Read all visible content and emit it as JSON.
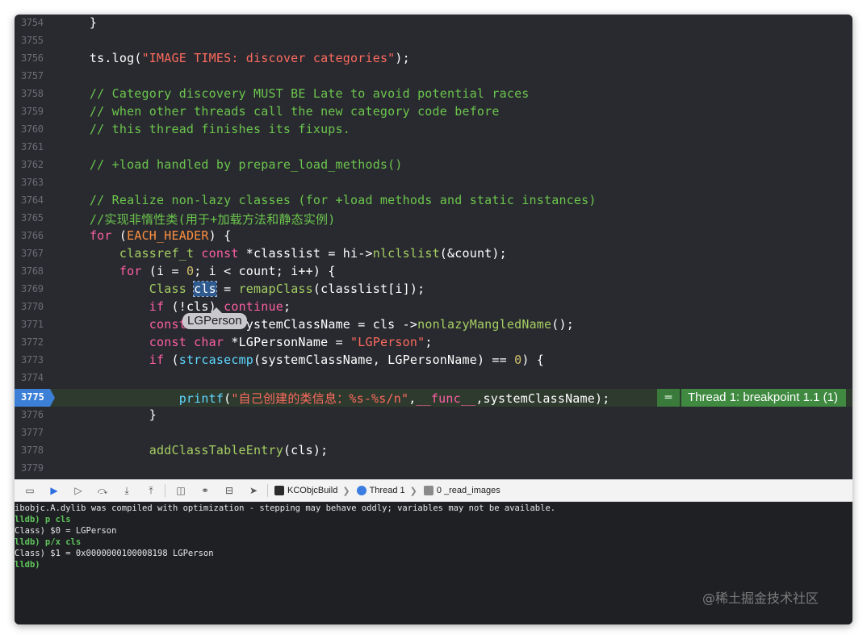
{
  "editor": {
    "lines": [
      {
        "n": "3754",
        "segs": [
          {
            "t": "    }",
            "c": ""
          }
        ]
      },
      {
        "n": "3755",
        "segs": []
      },
      {
        "n": "3756",
        "segs": [
          {
            "t": "    ts.",
            "c": ""
          },
          {
            "t": "log",
            "c": ""
          },
          {
            "t": "(",
            "c": ""
          },
          {
            "t": "\"IMAGE TIMES: discover categories\"",
            "c": "st"
          },
          {
            "t": ");",
            "c": ""
          }
        ]
      },
      {
        "n": "3757",
        "segs": []
      },
      {
        "n": "3758",
        "segs": [
          {
            "t": "    // Category discovery MUST BE Late to avoid potential races",
            "c": "cm"
          }
        ]
      },
      {
        "n": "3759",
        "segs": [
          {
            "t": "    // when other threads call the new category code before",
            "c": "cm"
          }
        ]
      },
      {
        "n": "3760",
        "segs": [
          {
            "t": "    // this thread finishes its fixups.",
            "c": "cm"
          }
        ]
      },
      {
        "n": "3761",
        "segs": []
      },
      {
        "n": "3762",
        "segs": [
          {
            "t": "    // +load handled by prepare_load_methods()",
            "c": "cm"
          }
        ]
      },
      {
        "n": "3763",
        "segs": []
      },
      {
        "n": "3764",
        "segs": [
          {
            "t": "    // Realize non-lazy classes (for +load methods and static instances)",
            "c": "cm"
          }
        ]
      },
      {
        "n": "3765",
        "segs": [
          {
            "t": "    //实现非惰性类(用于+加载方法和静态实例)",
            "c": "cm"
          }
        ]
      },
      {
        "n": "3766",
        "segs": [
          {
            "t": "    ",
            "c": ""
          },
          {
            "t": "for",
            "c": "kw"
          },
          {
            "t": " (",
            "c": ""
          },
          {
            "t": "EACH_HEADER",
            "c": "mac"
          },
          {
            "t": ") {",
            "c": ""
          }
        ]
      },
      {
        "n": "3767",
        "segs": [
          {
            "t": "        ",
            "c": ""
          },
          {
            "t": "classref_t",
            "c": "fn"
          },
          {
            "t": " ",
            "c": ""
          },
          {
            "t": "const",
            "c": "kw"
          },
          {
            "t": " *classlist = hi->",
            "c": ""
          },
          {
            "t": "nlclslist",
            "c": "fn"
          },
          {
            "t": "(&count);",
            "c": ""
          }
        ]
      },
      {
        "n": "3768",
        "segs": [
          {
            "t": "        ",
            "c": ""
          },
          {
            "t": "for",
            "c": "kw"
          },
          {
            "t": " (i = ",
            "c": ""
          },
          {
            "t": "0",
            "c": "num"
          },
          {
            "t": "; i < count; i++) {",
            "c": ""
          }
        ]
      },
      {
        "n": "3769",
        "segs": [
          {
            "t": "            ",
            "c": ""
          },
          {
            "t": "Class",
            "c": "fn"
          },
          {
            "t": " ",
            "c": ""
          },
          {
            "t": "cls",
            "c": "cur"
          },
          {
            "t": " = ",
            "c": ""
          },
          {
            "t": "remapClass",
            "c": "fn"
          },
          {
            "t": "(classlist[i]);",
            "c": ""
          }
        ]
      },
      {
        "n": "3770",
        "segs": [
          {
            "t": "            ",
            "c": ""
          },
          {
            "t": "if",
            "c": "kw"
          },
          {
            "t": " (!cls) ",
            "c": ""
          },
          {
            "t": "continue",
            "c": "kw"
          },
          {
            "t": ";",
            "c": ""
          }
        ]
      },
      {
        "n": "3771",
        "segs": [
          {
            "t": "            ",
            "c": ""
          },
          {
            "t": "const",
            "c": "kw"
          },
          {
            "t": " ",
            "c": ""
          },
          {
            "t": "char",
            "c": "kw"
          },
          {
            "t": " *systemClassName = cls ->",
            "c": ""
          },
          {
            "t": "nonlazyMangledName",
            "c": "fn"
          },
          {
            "t": "();",
            "c": ""
          }
        ]
      },
      {
        "n": "3772",
        "segs": [
          {
            "t": "            ",
            "c": ""
          },
          {
            "t": "const",
            "c": "kw"
          },
          {
            "t": " ",
            "c": ""
          },
          {
            "t": "char",
            "c": "kw"
          },
          {
            "t": " *LGPersonName = ",
            "c": ""
          },
          {
            "t": "\"LGPerson\"",
            "c": "st"
          },
          {
            "t": ";",
            "c": ""
          }
        ]
      },
      {
        "n": "3773",
        "segs": [
          {
            "t": "            ",
            "c": ""
          },
          {
            "t": "if",
            "c": "kw"
          },
          {
            "t": " (",
            "c": ""
          },
          {
            "t": "strcasecmp",
            "c": "meth"
          },
          {
            "t": "(systemClassName, LGPersonName) == ",
            "c": ""
          },
          {
            "t": "0",
            "c": "num"
          },
          {
            "t": ") {",
            "c": ""
          }
        ]
      },
      {
        "n": "3774",
        "segs": []
      }
    ],
    "bp_line": {
      "n": "3775",
      "segs": [
        {
          "t": "                ",
          "c": ""
        },
        {
          "t": "printf",
          "c": "meth"
        },
        {
          "t": "(",
          "c": ""
        },
        {
          "t": "\"自己创建的类信息：%s-%s/n\"",
          "c": "st"
        },
        {
          "t": ",",
          "c": ""
        },
        {
          "t": "__func__",
          "c": "kw"
        },
        {
          "t": ",systemClassName);",
          "c": ""
        }
      ],
      "badge_symbol": "═",
      "badge_text": "Thread 1: breakpoint 1.1 (1)"
    },
    "after_lines": [
      {
        "n": "3776",
        "segs": [
          {
            "t": "            }",
            "c": ""
          }
        ]
      },
      {
        "n": "3777",
        "segs": []
      },
      {
        "n": "3778",
        "segs": [
          {
            "t": "            ",
            "c": ""
          },
          {
            "t": "addClassTableEntry",
            "c": "fn"
          },
          {
            "t": "(cls);",
            "c": ""
          }
        ]
      },
      {
        "n": "3779",
        "segs": []
      }
    ],
    "tooltip": "LGPerson"
  },
  "debugbar": {
    "buttons": [
      {
        "name": "hide-debug-area-icon",
        "glyph": "▭"
      },
      {
        "name": "breakpoints-toggle-icon",
        "glyph": "▶",
        "active": true
      },
      {
        "name": "continue-icon",
        "glyph": "▷"
      },
      {
        "name": "step-over-icon",
        "glyph": "⤼"
      },
      {
        "name": "step-into-icon",
        "glyph": "⤓"
      },
      {
        "name": "step-out-icon",
        "glyph": "⤒"
      },
      {
        "name": "view-hierarchy-icon",
        "glyph": "◫"
      },
      {
        "name": "memory-graph-icon",
        "glyph": "⚭"
      },
      {
        "name": "environment-overrides-icon",
        "glyph": "⊟"
      },
      {
        "name": "simulate-location-icon",
        "glyph": "➤"
      }
    ],
    "breadcrumbs": [
      {
        "label": "KCObjcBuild",
        "icon": "terminal-icon",
        "color": "#2b2b2b"
      },
      {
        "label": "Thread 1",
        "icon": "thread-icon",
        "color": "#3b7de0"
      },
      {
        "label": "0 _read_images",
        "icon": "frame-icon",
        "color": "#8a8a8a"
      }
    ]
  },
  "console": {
    "lines": [
      {
        "prefix": "",
        "text": "ibobjc.A.dylib was compiled with optimization - stepping may behave oddly; variables may not be available."
      },
      {
        "prefix": "lldb)",
        "text": " p cls"
      },
      {
        "prefix": "",
        "text": "Class) $0 = LGPerson"
      },
      {
        "prefix": "lldb)",
        "text": " p/x cls"
      },
      {
        "prefix": "",
        "text": "Class) $1 = 0x0000000100008198 LGPerson"
      },
      {
        "prefix": "lldb)",
        "text": ""
      }
    ]
  },
  "watermark": "@稀土掘金技术社区",
  "colors": {
    "editor_bg": "#292a30",
    "comment": "#6bc54c",
    "keyword": "#fc5fa3",
    "string": "#fc6a5d",
    "breakpoint_blue": "#3b80d6",
    "thread_badge_green": "#3f8a40"
  }
}
